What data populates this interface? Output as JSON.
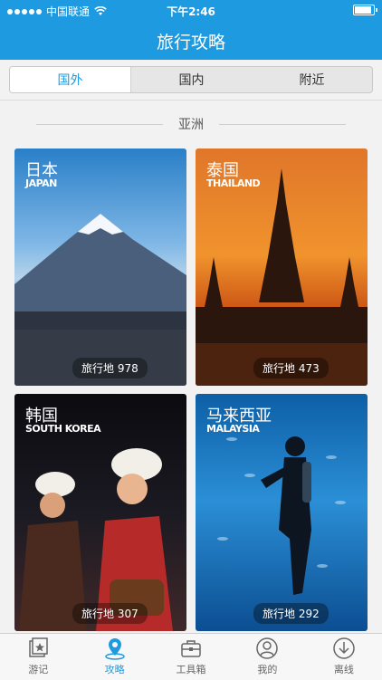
{
  "status": {
    "carrier": "中国联通",
    "time": "下午2:46"
  },
  "nav": {
    "title": "旅行攻略"
  },
  "tabs": [
    {
      "label": "国外",
      "active": true
    },
    {
      "label": "国内",
      "active": false
    },
    {
      "label": "附近",
      "active": false
    }
  ],
  "section": {
    "title": "亚洲"
  },
  "destinations": [
    {
      "cn": "日本",
      "en": "JAPAN",
      "count": "旅行地 978"
    },
    {
      "cn": "泰国",
      "en": "THAILAND",
      "count": "旅行地 473"
    },
    {
      "cn": "韩国",
      "en": "SOUTH KOREA",
      "count": "旅行地 307"
    },
    {
      "cn": "马来西亚",
      "en": "MALAYSIA",
      "count": "旅行地 292"
    }
  ],
  "tabbar": [
    {
      "label": "游记",
      "icon": "travel-notes-icon",
      "active": false
    },
    {
      "label": "攻略",
      "icon": "location-pin-icon",
      "active": true
    },
    {
      "label": "工具箱",
      "icon": "toolbox-icon",
      "active": false
    },
    {
      "label": "我的",
      "icon": "user-icon",
      "active": false
    },
    {
      "label": "离线",
      "icon": "download-icon",
      "active": false
    }
  ],
  "colors": {
    "brand": "#1e9be0",
    "background": "#f2f2f2"
  }
}
